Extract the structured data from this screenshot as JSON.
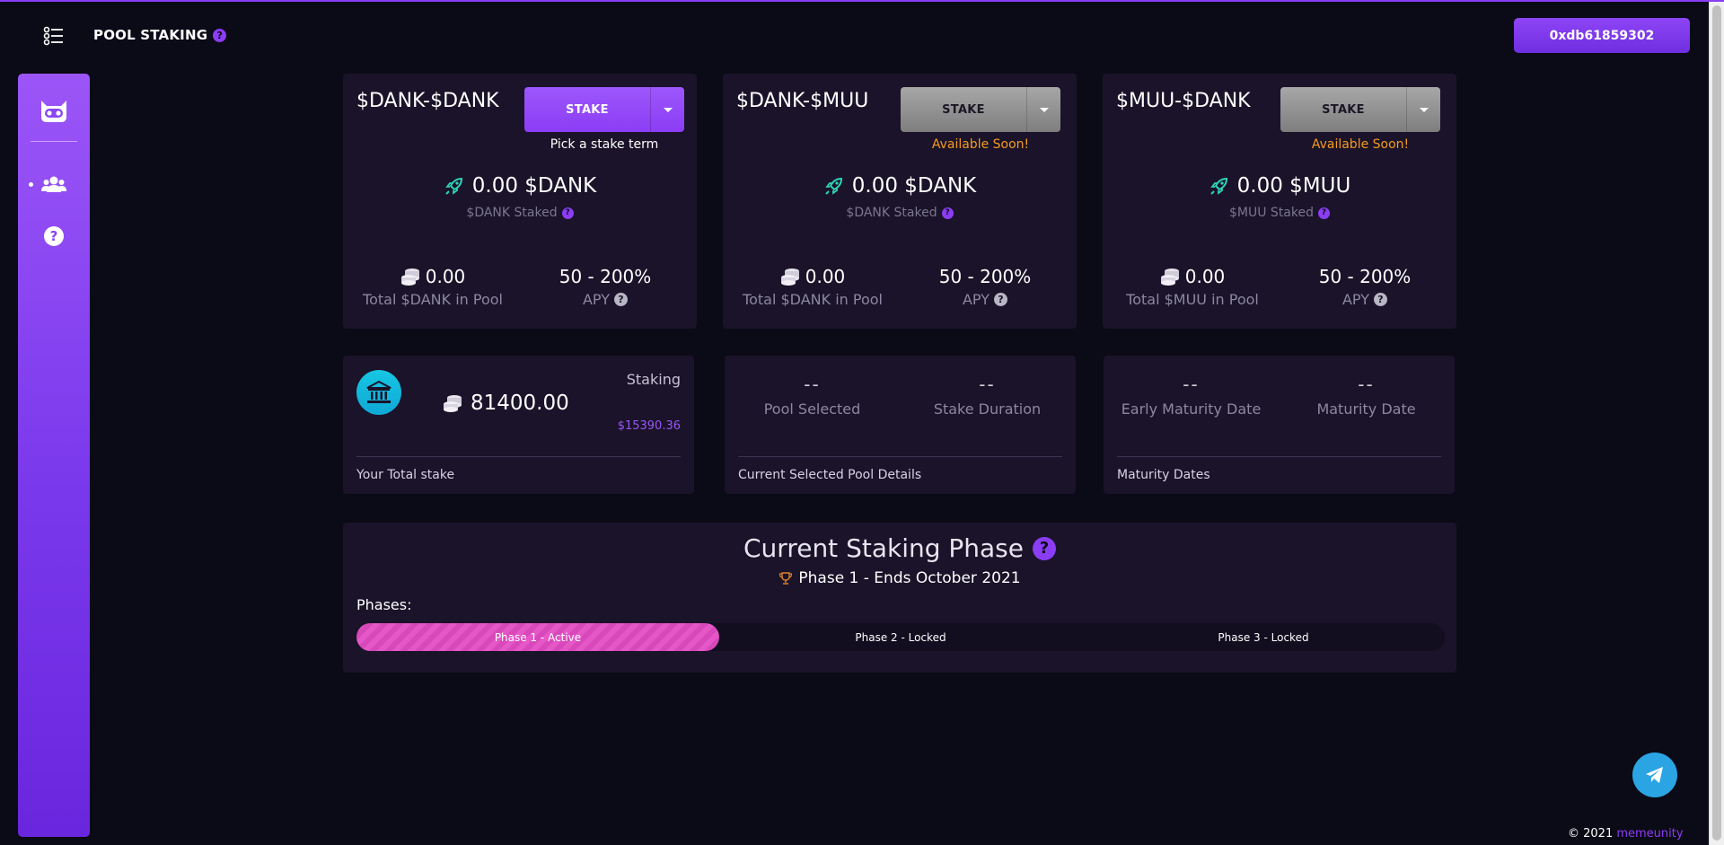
{
  "header": {
    "title": "POOL STAKING",
    "title_help": "?",
    "wallet_address": "0xdb61859302"
  },
  "sidebar": {
    "items": [
      {
        "icon": "users-icon",
        "active": true
      },
      {
        "icon": "help-icon",
        "label": "?"
      }
    ]
  },
  "pools": [
    {
      "name": "$DANK-$DANK",
      "stake_label": "STAKE",
      "note": "Pick a stake term",
      "staked_amount": "0.00 $DANK",
      "staked_label": "$DANK Staked",
      "pool_total": "0.00",
      "pool_total_label": "Total $DANK in Pool",
      "apy": "50 - 200%",
      "apy_label": "APY"
    },
    {
      "name": "$DANK-$MUU",
      "stake_label": "STAKE",
      "note": "Available Soon!",
      "staked_amount": "0.00 $DANK",
      "staked_label": "$DANK Staked",
      "pool_total": "0.00",
      "pool_total_label": "Total $DANK in Pool",
      "apy": "50 - 200%",
      "apy_label": "APY"
    },
    {
      "name": "$MUU-$DANK",
      "stake_label": "STAKE",
      "note": "Available Soon!",
      "staked_amount": "0.00 $MUU",
      "staked_label": "$MUU Staked",
      "pool_total": "0.00",
      "pool_total_label": "Total $MUU in Pool",
      "apy": "50 - 200%",
      "apy_label": "APY"
    }
  ],
  "total_stake": {
    "amount": "81400.00",
    "label": "Staking",
    "usd": "$15390.36",
    "footer": "Your Total stake"
  },
  "selected_pool": {
    "pool_value": "--",
    "pool_label": "Pool Selected",
    "duration_value": "--",
    "duration_label": "Stake Duration",
    "footer": "Current Selected Pool Details"
  },
  "maturity": {
    "early_value": "--",
    "early_label": "Early Maturity Date",
    "maturity_value": "--",
    "maturity_label": "Maturity Date",
    "footer": "Maturity Dates"
  },
  "phase": {
    "title": "Current Staking Phase",
    "title_help": "?",
    "current": "Phase 1 - Ends October 2021",
    "phases_label": "Phases:",
    "segments": [
      "Phase 1 - Active",
      "Phase 2 - Locked",
      "Phase 3 - Locked"
    ]
  },
  "footer": {
    "copyright": "© 2021",
    "brand": "memeunity"
  },
  "colors": {
    "accent": "#8b3df5",
    "background": "#0b0a17",
    "card": "#1a1329",
    "soon": "#f59b1f",
    "phase_active": "#e557c7",
    "bank_icon": "#16c7e3",
    "telegram": "#2ba4e3"
  }
}
